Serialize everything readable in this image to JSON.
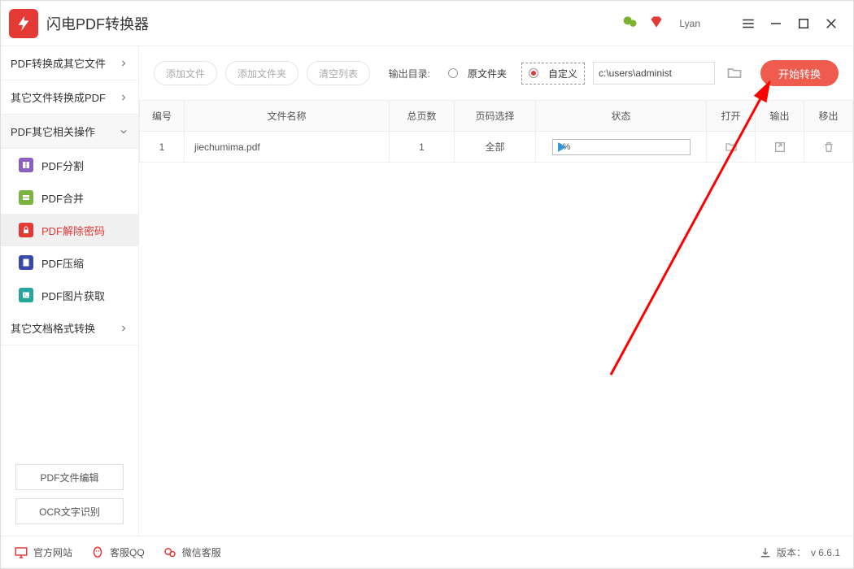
{
  "app": {
    "title": "闪电PDF转换器",
    "user": "Lyan"
  },
  "sidebar": {
    "cats": [
      {
        "label": "PDF转换成其它文件"
      },
      {
        "label": "其它文件转换成PDF"
      },
      {
        "label": "PDF其它相关操作"
      },
      {
        "label": "其它文档格式转换"
      }
    ],
    "subs": [
      {
        "label": "PDF分割"
      },
      {
        "label": "PDF合并"
      },
      {
        "label": "PDF解除密码"
      },
      {
        "label": "PDF压缩"
      },
      {
        "label": "PDF图片获取"
      }
    ],
    "bottom": [
      {
        "label": "PDF文件编辑"
      },
      {
        "label": "OCR文字识别"
      }
    ]
  },
  "toolbar": {
    "add_file": "添加文件",
    "add_folder": "添加文件夹",
    "clear_list": "清空列表",
    "output_label": "输出目录:",
    "radio_source": "原文件夹",
    "radio_custom": "自定义",
    "path_value": "c:\\users\\administ",
    "start": "开始转换"
  },
  "table": {
    "headers": {
      "idx": "编号",
      "name": "文件名称",
      "pages": "总页数",
      "range": "页码选择",
      "status": "状态",
      "open": "打开",
      "out": "输出",
      "rm": "移出"
    },
    "rows": [
      {
        "idx": "1",
        "name": "jiechumima.pdf",
        "pages": "1",
        "range": "全部",
        "progress": "0%"
      }
    ]
  },
  "footer": {
    "site": "官方网站",
    "qq": "客服QQ",
    "wx": "微信客服",
    "ver_label": "版本：",
    "ver": "v 6.6.1"
  }
}
